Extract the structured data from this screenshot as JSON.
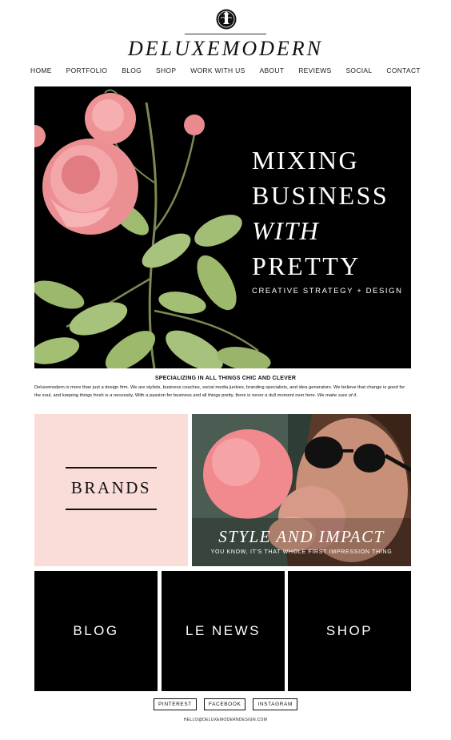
{
  "brand": {
    "name": "DELUXEMODERN",
    "logo_icon": "crest-icon"
  },
  "nav": {
    "items": [
      "HOME",
      "PORTFOLIO",
      "BLOG",
      "SHOP",
      "WORK WITH US",
      "ABOUT",
      "REVIEWS",
      "SOCIAL",
      "CONTACT"
    ]
  },
  "hero": {
    "line1": "MIXING",
    "line2": "BUSINESS",
    "line3": "WITH",
    "line4": "PRETTY",
    "tagline": "CREATIVE STRATEGY + DESIGN",
    "image": "pink-roses-illustration"
  },
  "intro": {
    "heading": "SPECIALIZING IN ALL THINGS CHIC AND CLEVER",
    "body": "Deluxemodern is more than just a design firm. We are stylists, business coaches, social media junkies, branding specialists, and idea generators. We believe that change is good for the soul, and keeping things fresh is a necessity. With a passion for business and all things pretty,  there is never a dull moment over here. ",
    "body_emphasis": "We make sure of it."
  },
  "tiles": {
    "brands": "BRANDS",
    "style_title": "STYLE AND IMPACT",
    "style_sub": "YOU KNOW, IT'S THAT WHOLE FIRST IMPRESSION THING",
    "blog": "BLOG",
    "news": "LE NEWS",
    "shop": "SHOP"
  },
  "social": {
    "pinterest": "PINTEREST",
    "facebook": "FACEBOOK",
    "instagram": "INSTAGRAM"
  },
  "footer": {
    "email": "HELLO@DELUXEMODERNDESIGN.COM"
  },
  "colors": {
    "blush": "#fadcd9",
    "black": "#000000",
    "rose": "#f08a8e"
  }
}
